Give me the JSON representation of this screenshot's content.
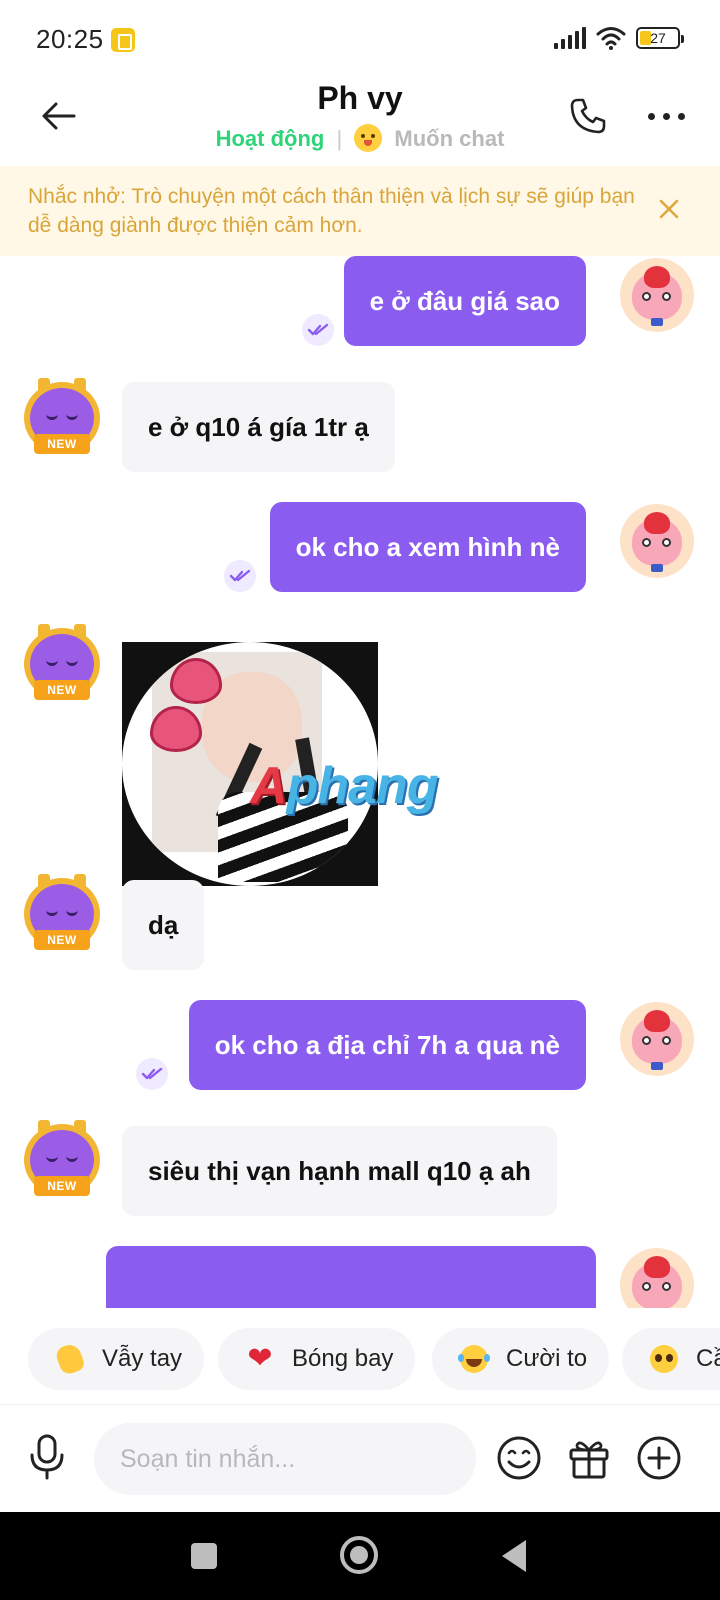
{
  "status_bar": {
    "time": "20:25",
    "battery_level": "27"
  },
  "header": {
    "title": "Ph vy",
    "status_active": "Hoạt động",
    "separator": "|",
    "status_want_chat": "Muốn chat",
    "accent_active_color": "#2ed47a"
  },
  "notice": {
    "text": "Nhắc nhở: Trò chuyện một cách thân thiện và lịch sự sẽ giúp bạn dễ dàng giành được thiện cảm hơn."
  },
  "messages": [
    {
      "sender": "me",
      "text": "e ở đâu giá sao",
      "read": true
    },
    {
      "sender": "other",
      "text": "e ở q10 á gía 1tr ạ"
    },
    {
      "sender": "me",
      "text": "ok cho a xem hình nè",
      "read": true
    },
    {
      "sender": "other",
      "type": "image"
    },
    {
      "sender": "other",
      "text": "dạ"
    },
    {
      "sender": "me",
      "text": "ok cho a địa chỉ 7h a qua nè",
      "read": true
    },
    {
      "sender": "other",
      "text": "siêu thị vạn hạnh mall q10 ạ ah"
    },
    {
      "sender": "me",
      "text": "",
      "read": false
    }
  ],
  "avatar_other_badge": "NEW",
  "watermark": {
    "first_letter": "A",
    "rest": "phang"
  },
  "reactions": [
    {
      "icon": "waving-hand-icon",
      "label": "Vẫy tay"
    },
    {
      "icon": "heart-icon",
      "label": "Bóng bay"
    },
    {
      "icon": "laughing-face-icon",
      "label": "Cười to"
    },
    {
      "icon": "pleading-face-icon",
      "label": "Cầ"
    }
  ],
  "input": {
    "placeholder": "Soạn tin nhắn..."
  },
  "colors": {
    "my_bubble": "#8a5cf0",
    "other_bubble": "#f5f5f7",
    "notice_bg": "#fff8e6",
    "notice_text": "#d9a53a"
  }
}
